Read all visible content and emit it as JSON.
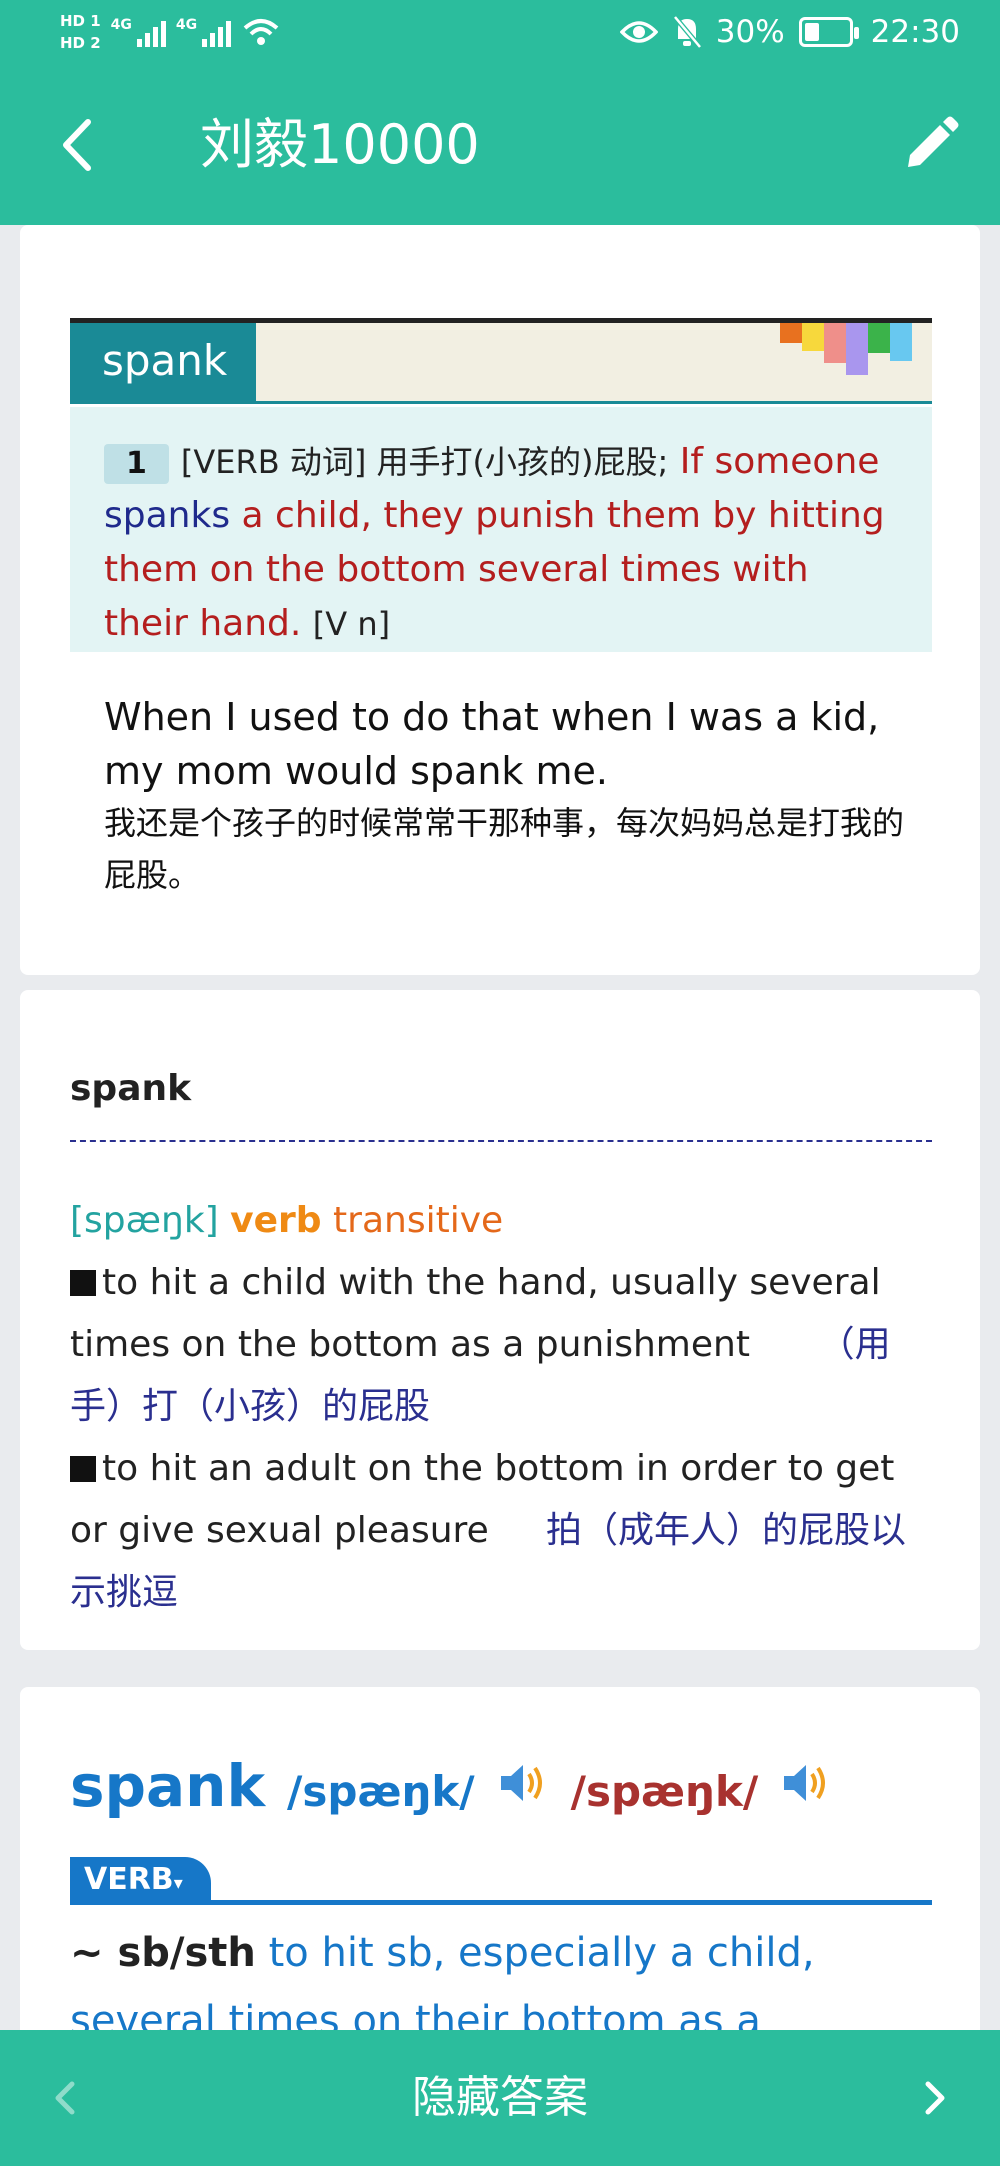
{
  "status_bar": {
    "hd1": "HD 1",
    "hd2": "HD 2",
    "net1": "4G",
    "net2": "4G",
    "battery": "30%",
    "time": "22:30"
  },
  "header": {
    "title": "刘毅10000"
  },
  "card1": {
    "word": "spank",
    "sense_number": "1",
    "sense_meta": "[VERB 动词] 用手打(小孩的)屁股;",
    "definition_part1": "If someone",
    "definition_keyword": "spanks",
    "definition_part2": "a child, they punish them by hitting them on the bottom several times with their hand.",
    "pattern": "[V n]",
    "example_en": "When I used to do that when I was a kid, my mom would spank me.",
    "example_zh": "我还是个孩子的时候常常干那种事，每次妈妈总是打我的屁股。",
    "rainbow_colors": [
      "#e8711f",
      "#f7d83c",
      "#ef8f8a",
      "#a996ee",
      "#3bb34a",
      "#68c8f0"
    ]
  },
  "card2": {
    "word": "spank",
    "pronunciation": "[spæŋk]",
    "part_of_speech": "verb",
    "transitivity": "transitive",
    "sense1_en": "to hit a child with the hand, usually several times on the bottom as a punishment",
    "sense1_zh": "（用手）打（小孩）的屁股",
    "sense2_en": "to hit an adult on the bottom in order to get or give sexual pleasure",
    "sense2_zh": "拍（成年人）的屁股以示挑逗"
  },
  "card3": {
    "word": "spank",
    "ipa_uk": "/spæŋk/",
    "ipa_us": "/spæŋk/",
    "verb_tag": "VERB",
    "pattern": "~ sb/sth",
    "definition": "to hit sb, especially a child, several times on their bottom as a punishment 打"
  },
  "bottom_bar": {
    "hide_answer": "隐藏答案"
  },
  "colors": {
    "accent": "#2bbd9d",
    "dict_teal": "#1a8a96",
    "oxford_blue": "#1677c8"
  }
}
